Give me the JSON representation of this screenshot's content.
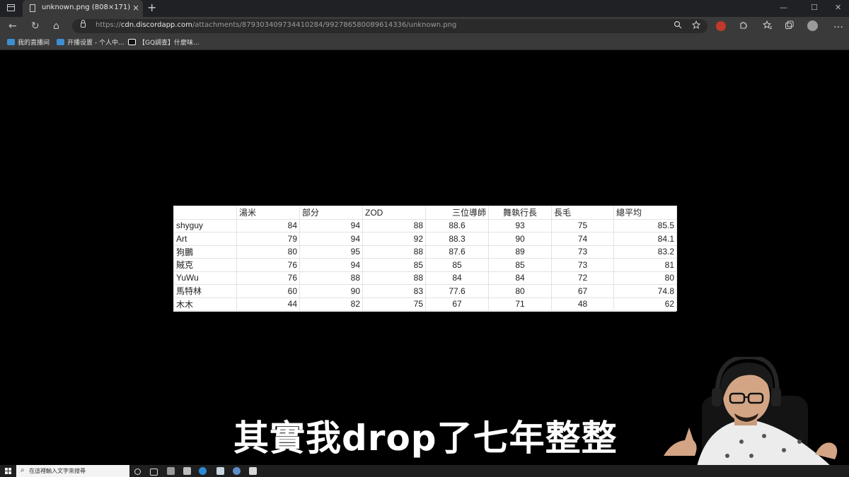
{
  "browser": {
    "tab": {
      "title": "unknown.png (808×171)",
      "close": "×"
    },
    "new_tab": "+",
    "window_controls": {
      "minimize": "—",
      "maximize": "☐",
      "close": "✕"
    },
    "nav": {
      "back": "←",
      "refresh": "↻",
      "home": "⌂"
    },
    "url": {
      "protocol": "https://",
      "host": "cdn.discordapp.com",
      "path": "/attachments/879303409734410284/992786580089614336/unknown.png"
    },
    "icons": [
      "zoom-icon",
      "favorite-add-icon",
      "extension-red-icon",
      "extensions-icon",
      "favorites-icon",
      "collections-icon",
      "profile-icon",
      "menu-icon"
    ],
    "bookmarks": [
      {
        "label": "我的直播间",
        "icon": "bilibili-icon"
      },
      {
        "label": "开播设置 - 个人中...",
        "icon": "bilibili-icon"
      },
      {
        "label": "【GQ調查】什麼味...",
        "icon": "gq-icon"
      }
    ]
  },
  "table": {
    "headers": [
      "",
      "湯米",
      "部分",
      "ZOD",
      "三位導師",
      "舞執行長",
      "長毛",
      "總平均"
    ],
    "rows": [
      {
        "name": "shyguy",
        "values": [
          "84",
          "94",
          "88",
          "88.6",
          "93",
          "75",
          "85.5"
        ]
      },
      {
        "name": "Art",
        "values": [
          "79",
          "94",
          "92",
          "88.3",
          "90",
          "74",
          "84.1"
        ]
      },
      {
        "name": "狗鵬",
        "values": [
          "80",
          "95",
          "88",
          "87.6",
          "89",
          "73",
          "83.2"
        ]
      },
      {
        "name": "賊克",
        "values": [
          "76",
          "94",
          "85",
          "85",
          "85",
          "73",
          "81"
        ]
      },
      {
        "name": "YuWu",
        "values": [
          "76",
          "88",
          "88",
          "84",
          "84",
          "72",
          "80"
        ]
      },
      {
        "name": "馬特林",
        "values": [
          "60",
          "90",
          "83",
          "77.6",
          "80",
          "67",
          "74.8"
        ]
      },
      {
        "name": "木木",
        "values": [
          "44",
          "82",
          "75",
          "67",
          "71",
          "48",
          "62"
        ]
      }
    ]
  },
  "subtitle": "其實我drop了七年整整",
  "taskbar": {
    "search_placeholder": "在這裡輸入文字來搜尋"
  }
}
